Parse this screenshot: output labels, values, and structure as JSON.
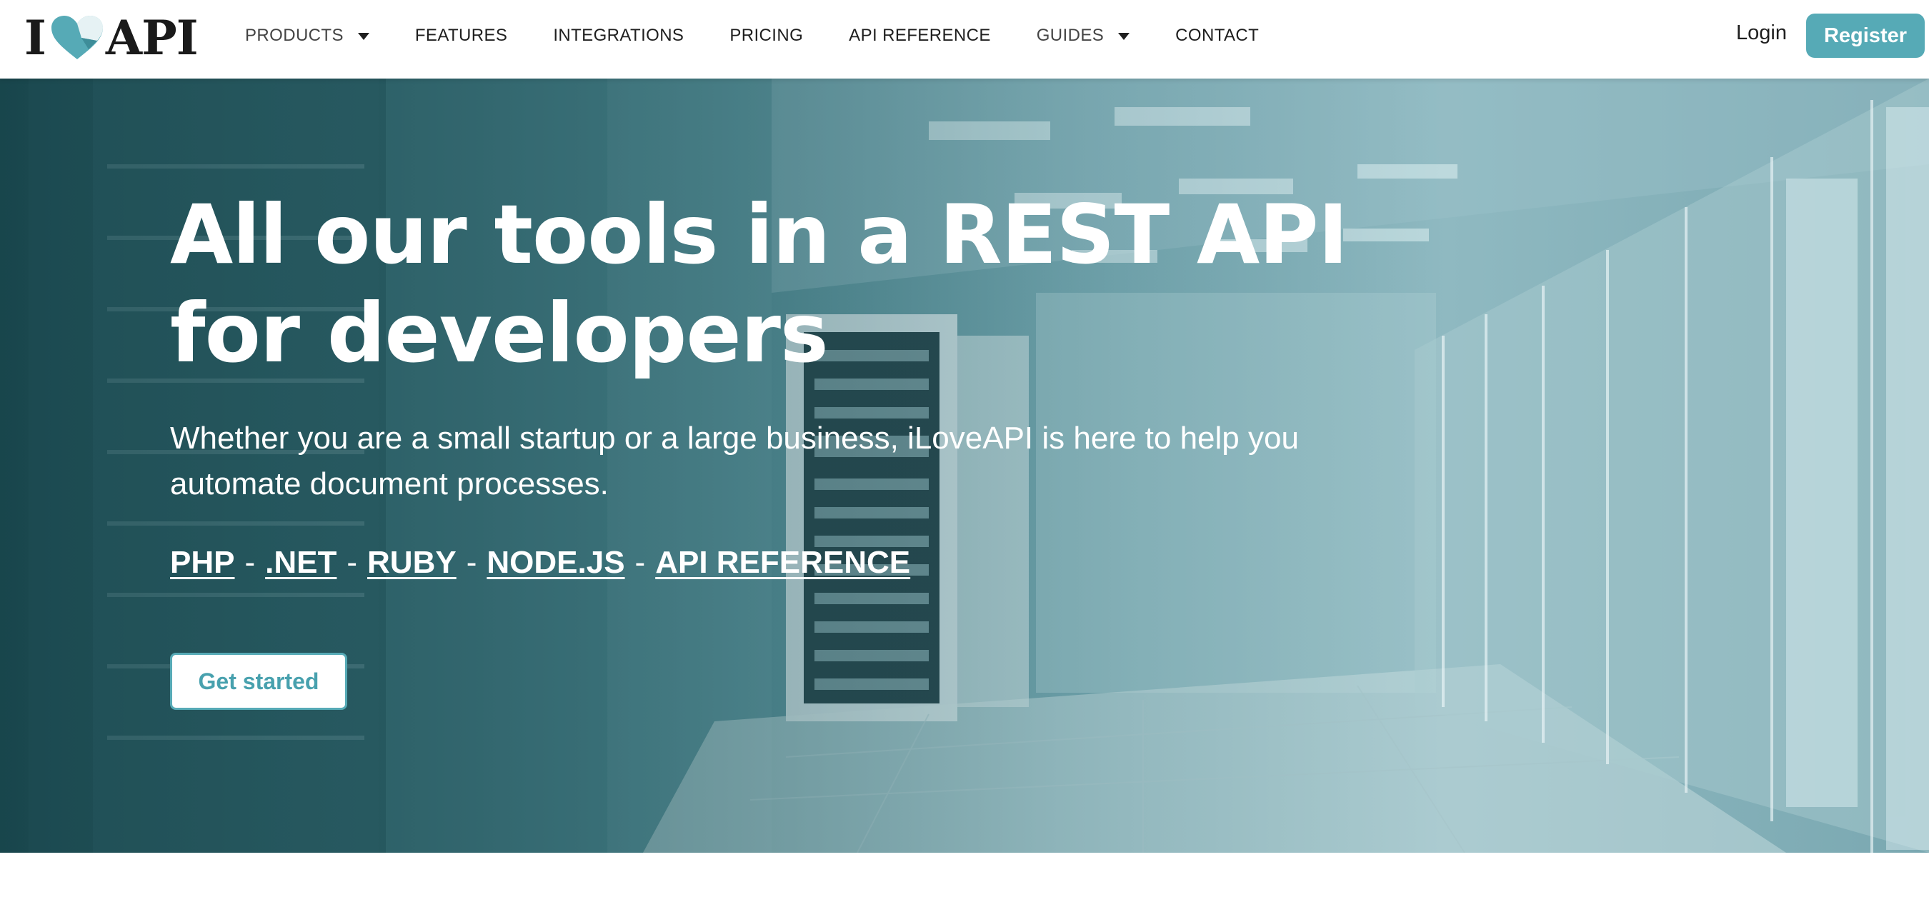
{
  "logo": {
    "prefix": "I",
    "suffix": "API",
    "icon": "heart-icon"
  },
  "nav": {
    "items": [
      {
        "label": "PRODUCTS",
        "dropdown": true
      },
      {
        "label": "FEATURES",
        "dropdown": false
      },
      {
        "label": "INTEGRATIONS",
        "dropdown": false
      },
      {
        "label": "PRICING",
        "dropdown": false
      },
      {
        "label": "API REFERENCE",
        "dropdown": false
      },
      {
        "label": "GUIDES",
        "dropdown": true
      },
      {
        "label": "CONTACT",
        "dropdown": false
      }
    ],
    "login": "Login",
    "register": "Register"
  },
  "hero": {
    "title": "All our tools in a REST API for developers",
    "subtitle": "Whether you are a small startup or a large business, iLoveAPI is here to help you automate document processes.",
    "links": [
      "PHP",
      ".NET",
      "RUBY",
      "NODE.JS",
      "API REFERENCE"
    ],
    "separator": "-",
    "cta": "Get started"
  },
  "colors": {
    "accent": "#56aab6",
    "hero_dark": "#1e4f56",
    "hero_light": "#8fb9c1",
    "text": "#1f1f1f"
  }
}
